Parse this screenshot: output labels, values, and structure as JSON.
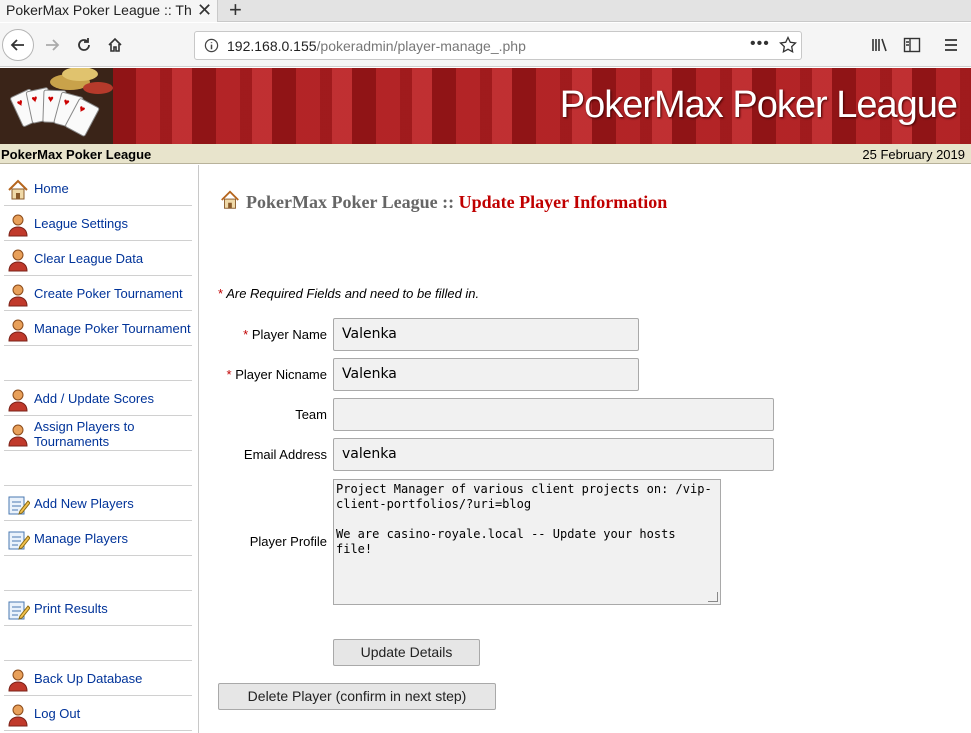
{
  "browser": {
    "tab_title": "PokerMax Poker League :: Th",
    "url_host": "192.168.0.155",
    "url_path": "/pokeradmin/player-manage_.php"
  },
  "site": {
    "banner_title": "PokerMax Poker League",
    "subbar_title": "PokerMax Poker League",
    "date": "25 February 2019"
  },
  "sidebar": {
    "items": [
      {
        "label": "Home"
      },
      {
        "label": "League Settings"
      },
      {
        "label": "Clear League Data"
      },
      {
        "label": "Create Poker Tournament"
      },
      {
        "label": "Manage Poker Tournament"
      },
      {
        "label": "Add / Update Scores"
      },
      {
        "label": "Assign Players to Tournaments"
      },
      {
        "label": "Add New Players"
      },
      {
        "label": "Manage Players"
      },
      {
        "label": "Print Results"
      },
      {
        "label": "Back Up Database"
      },
      {
        "label": "Log Out"
      }
    ]
  },
  "main": {
    "heading_prefix": "PokerMax Poker League ::",
    "heading_accent": "Update Player Information",
    "required_star": "*",
    "required_note": "Are Required Fields and need to be filled in.",
    "fields": {
      "player_name_label": "Player Name",
      "player_name_value": "Valenka",
      "player_nick_label": "Player Nicname",
      "player_nick_value": "Valenka",
      "team_label": "Team",
      "team_value": "",
      "email_label": "Email Address",
      "email_value": "valenka",
      "profile_label": "Player Profile",
      "profile_value": "Project Manager of various client projects on: /vip-client-portfolios/?uri=blog\n\nWe are casino-royale.local -- Update your hosts file!"
    },
    "update_button": "Update Details",
    "delete_button": "Delete Player (confirm in next step)"
  }
}
